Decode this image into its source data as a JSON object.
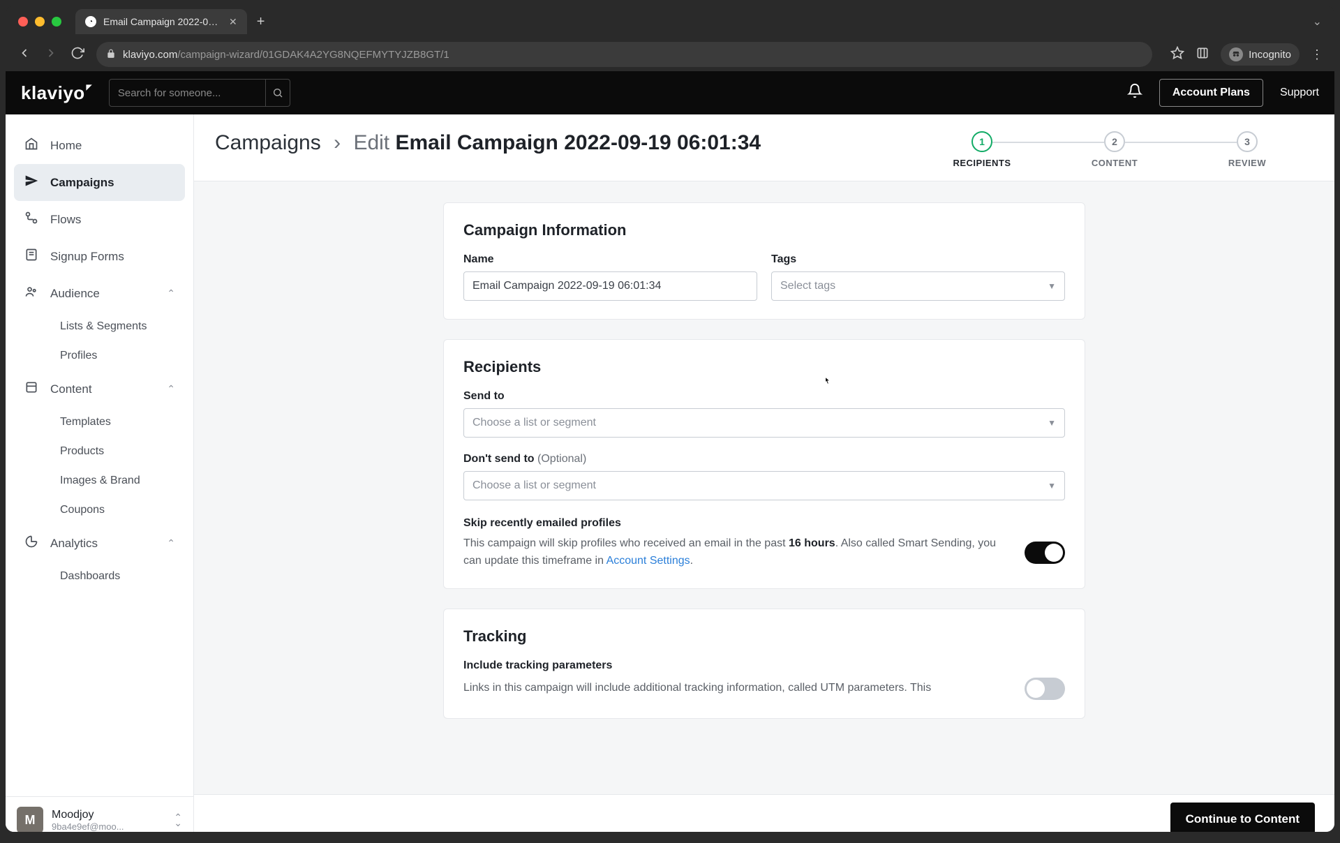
{
  "browser": {
    "tab_title": "Email Campaign 2022-09-19 0",
    "url_host": "klaviyo.com",
    "url_path": "/campaign-wizard/01GDAK4A2YG8NQEFMYTYJZB8GT/1",
    "incognito_label": "Incognito"
  },
  "header": {
    "logo_text": "klaviyo",
    "search_placeholder": "Search for someone...",
    "account_plans": "Account Plans",
    "support": "Support"
  },
  "sidebar": {
    "items": {
      "home": "Home",
      "campaigns": "Campaigns",
      "flows": "Flows",
      "signup_forms": "Signup Forms",
      "audience": "Audience",
      "lists_segments": "Lists & Segments",
      "profiles": "Profiles",
      "content": "Content",
      "templates": "Templates",
      "products": "Products",
      "images_brand": "Images & Brand",
      "coupons": "Coupons",
      "analytics": "Analytics",
      "dashboards": "Dashboards"
    },
    "user": {
      "initial": "M",
      "name": "Moodjoy",
      "email": "9ba4e9ef@moo..."
    }
  },
  "page": {
    "breadcrumb_root": "Campaigns",
    "edit_prefix": "Edit",
    "campaign_title": "Email Campaign 2022-09-19 06:01:34",
    "steps": [
      {
        "num": "1",
        "label": "RECIPIENTS"
      },
      {
        "num": "2",
        "label": "CONTENT"
      },
      {
        "num": "3",
        "label": "REVIEW"
      }
    ]
  },
  "form": {
    "campaign_info_heading": "Campaign Information",
    "name_label": "Name",
    "name_value": "Email Campaign 2022-09-19 06:01:34",
    "tags_label": "Tags",
    "tags_placeholder": "Select tags",
    "recipients_heading": "Recipients",
    "send_to_label": "Send to",
    "list_placeholder": "Choose a list or segment",
    "dont_send_label": "Don't send to",
    "optional_text": "(Optional)",
    "skip_heading": "Skip recently emailed profiles",
    "skip_desc_pre": "This campaign will skip profiles who received an email in the past ",
    "skip_hours": "16 hours",
    "skip_desc_mid": ". Also called Smart Sending, you can update this timeframe in ",
    "skip_link": "Account Settings",
    "skip_desc_post": ".",
    "tracking_heading": "Tracking",
    "tracking_sub": "Include tracking parameters",
    "tracking_desc": "Links in this campaign will include additional tracking information, called UTM parameters. This"
  },
  "footer": {
    "continue": "Continue to Content"
  }
}
